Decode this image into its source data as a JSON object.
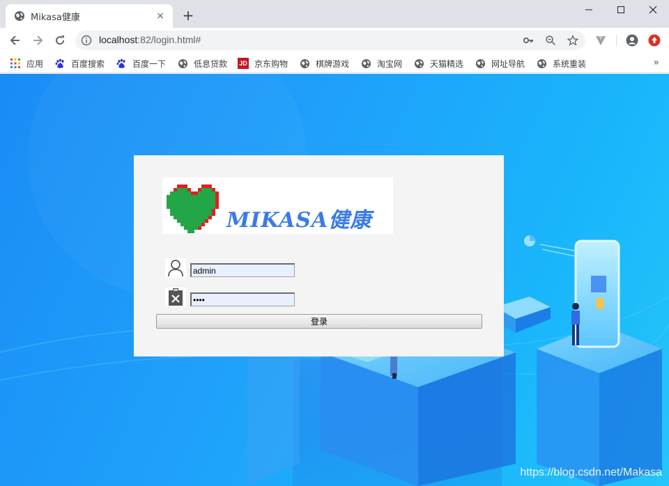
{
  "browser": {
    "tab": {
      "title": "Mikasa健康",
      "favicon": "globe-icon",
      "close": "×"
    },
    "new_tab": "+",
    "window_controls": {
      "minimize": "—",
      "maximize": "☐",
      "close": "✕"
    },
    "omnibox": {
      "url_host": "localhost",
      "url_rest": ":82/login.html#"
    },
    "bookmarks": [
      {
        "label": "应用",
        "icon": "apps-grid-icon"
      },
      {
        "label": "百度搜索",
        "icon": "baidu-paw-icon"
      },
      {
        "label": "百度一下",
        "icon": "baidu-paw-icon"
      },
      {
        "label": "低息贷款",
        "icon": "globe-icon"
      },
      {
        "label": "京东购物",
        "icon": "jd-icon",
        "badge": "JD"
      },
      {
        "label": "棋牌游戏",
        "icon": "globe-icon"
      },
      {
        "label": "淘宝网",
        "icon": "globe-icon"
      },
      {
        "label": "天猫精选",
        "icon": "globe-icon"
      },
      {
        "label": "网址导航",
        "icon": "globe-icon"
      },
      {
        "label": "系统重装",
        "icon": "globe-icon"
      }
    ],
    "bookmarks_more": "»"
  },
  "page": {
    "logo_text": "MIKASA健康",
    "username_value": "admin",
    "password_value": "••••",
    "login_button": "登录",
    "watermark": "https://blog.csdn.net/Makasa"
  },
  "colors": {
    "accent_blue": "#1a8cf5",
    "panel_bg": "#f4f4f4",
    "logo_blue": "#3b7ae8",
    "heart_green": "#22a648",
    "heart_red": "#e02020"
  }
}
